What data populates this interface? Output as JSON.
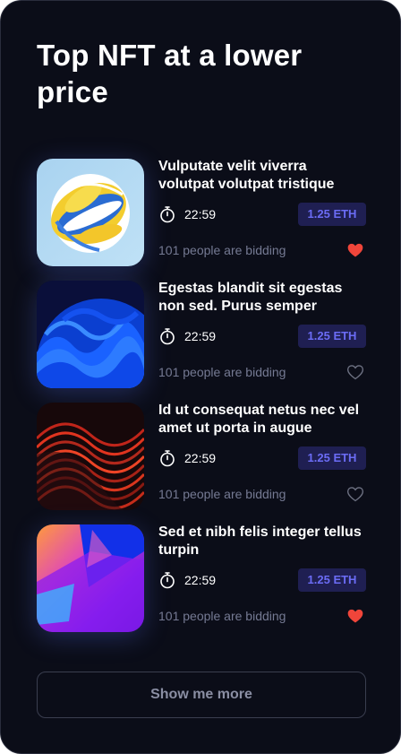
{
  "page": {
    "title": "Top NFT at a lower price",
    "more_button_label": "Show me more"
  },
  "items": [
    {
      "title": "Vulputate velit viverra volutpat volutpat tristique",
      "time": "22:59",
      "price": "1.25 ETH",
      "bidders": "101 people are bidding",
      "liked": true,
      "thumb_icon": "yellow-blue-swirl-sphere"
    },
    {
      "title": "Egestas blandit sit egestas non sed. Purus semper",
      "time": "22:59",
      "price": "1.25 ETH",
      "bidders": "101 people are bidding",
      "liked": false,
      "thumb_icon": "blue-wave-sphere"
    },
    {
      "title": "Id ut consequat netus nec vel amet ut porta in augue",
      "time": "22:59",
      "price": "1.25 ETH",
      "bidders": "101 people are bidding",
      "liked": false,
      "thumb_icon": "red-black-wave-lines"
    },
    {
      "title": "Sed et nibh felis integer tellus turpin",
      "time": "22:59",
      "price": "1.25 ETH",
      "bidders": "101 people are bidding",
      "liked": true,
      "thumb_icon": "purple-gradient-abstract"
    }
  ],
  "colors": {
    "background": "#0b0d18",
    "price_badge_bg": "#1f1f52",
    "price_badge_text": "#6b6cf5",
    "muted_text": "#757a93",
    "heart_liked": "#f0453a",
    "heart_outline": "#6e7283"
  }
}
